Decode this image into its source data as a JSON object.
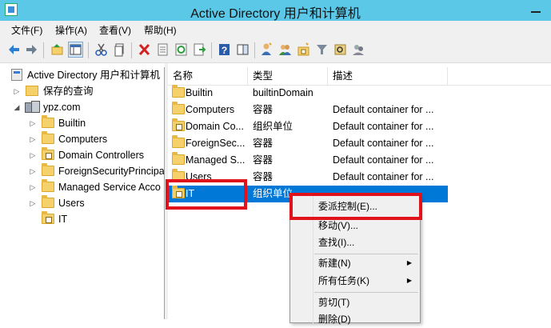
{
  "window": {
    "title": "Active Directory 用户和计算机"
  },
  "menu": [
    "文件(F)",
    "操作(A)",
    "查看(V)",
    "帮助(H)"
  ],
  "toolbar": {
    "icons": [
      "back-icon",
      "forward-icon",
      "up-folder-icon",
      "show-hide-tree-icon",
      "cut-icon",
      "copy-icon",
      "delete-icon",
      "properties-icon",
      "refresh-icon",
      "export-icon",
      "help-icon",
      "show-pane-icon",
      "new-user-icon",
      "new-group-icon",
      "new-ou-icon",
      "filter-icon",
      "find-icon",
      "add-to-group-icon"
    ]
  },
  "tree": {
    "root": "Active Directory 用户和计算机",
    "saved_queries": "保存的查询",
    "domain": "ypz.com",
    "children": [
      "Builtin",
      "Computers",
      "Domain Controllers",
      "ForeignSecurityPrincipa",
      "Managed Service Acco",
      "Users",
      "IT"
    ]
  },
  "list": {
    "columns": [
      "名称",
      "类型",
      "描述"
    ],
    "rows": [
      {
        "name": "Builtin",
        "type": "builtinDomain",
        "desc": ""
      },
      {
        "name": "Computers",
        "type": "容器",
        "desc": "Default container for ..."
      },
      {
        "name": "Domain Co...",
        "type": "组织单位",
        "desc": "Default container for ..."
      },
      {
        "name": "ForeignSec...",
        "type": "容器",
        "desc": "Default container for ..."
      },
      {
        "name": "Managed S...",
        "type": "容器",
        "desc": "Default container for ..."
      },
      {
        "name": "Users",
        "type": "容器",
        "desc": "Default container for ..."
      },
      {
        "name": "IT",
        "type": "组织单位",
        "desc": ""
      }
    ]
  },
  "context_menu": {
    "items": [
      "委派控制(E)...",
      "移动(V)...",
      "查找(I)...",
      "新建(N)",
      "所有任务(K)",
      "剪切(T)",
      "删除(D)"
    ]
  },
  "colors": {
    "titlebar": "#5bc8e8",
    "selection": "#0078d7",
    "highlight_box": "#e0121c"
  }
}
